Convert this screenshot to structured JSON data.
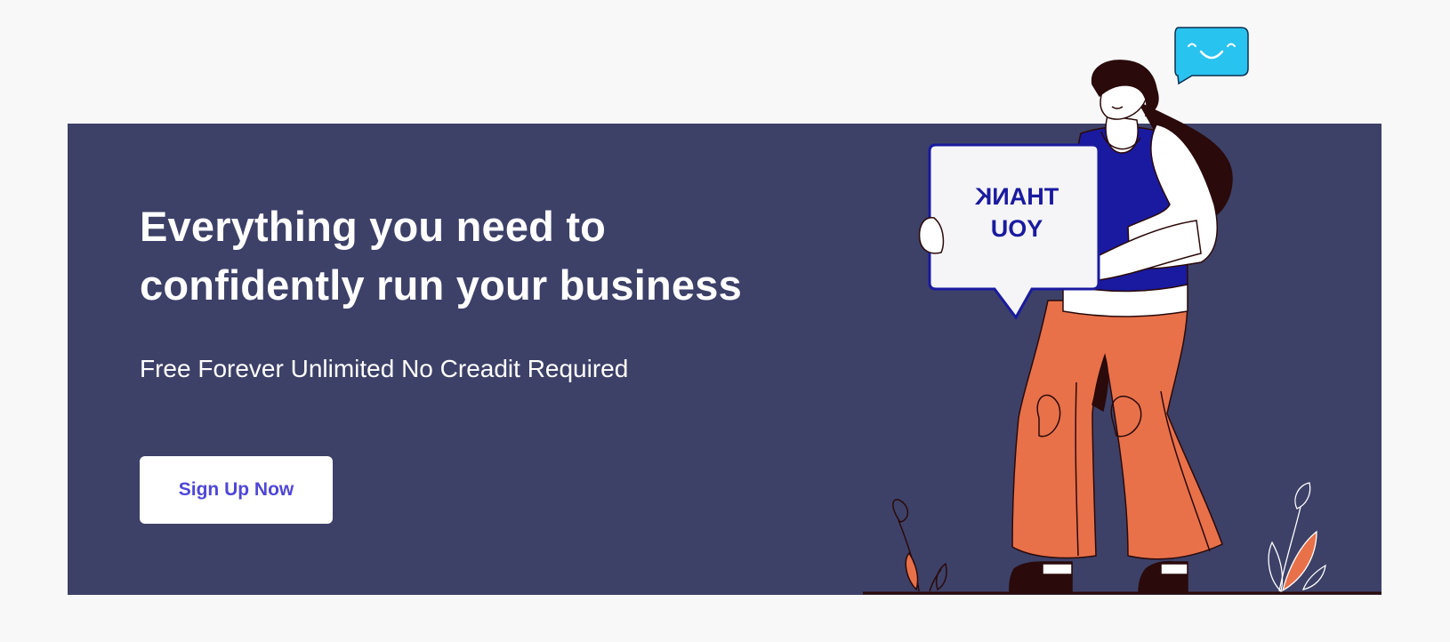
{
  "hero": {
    "headline_line1": "Everything you need to",
    "headline_line2": "confidently run your business",
    "subheadline": "Free Forever Unlimited No Creadit Required",
    "cta_label": "Sign Up Now"
  },
  "illustration": {
    "sign_line1": "THANK",
    "sign_line2": "YOU"
  },
  "colors": {
    "banner_bg": "#3d4168",
    "page_bg": "#f8f8f9",
    "cta_text": "#4f46d8",
    "pants": "#e8714a",
    "vest": "#1a1aa0",
    "hair": "#2a0a0a",
    "speech_bubble": "#29c3f0"
  },
  "icons": [
    "smiley-speech-bubble-icon",
    "thank-you-sign",
    "plant-left-icon",
    "plant-right-icon"
  ]
}
